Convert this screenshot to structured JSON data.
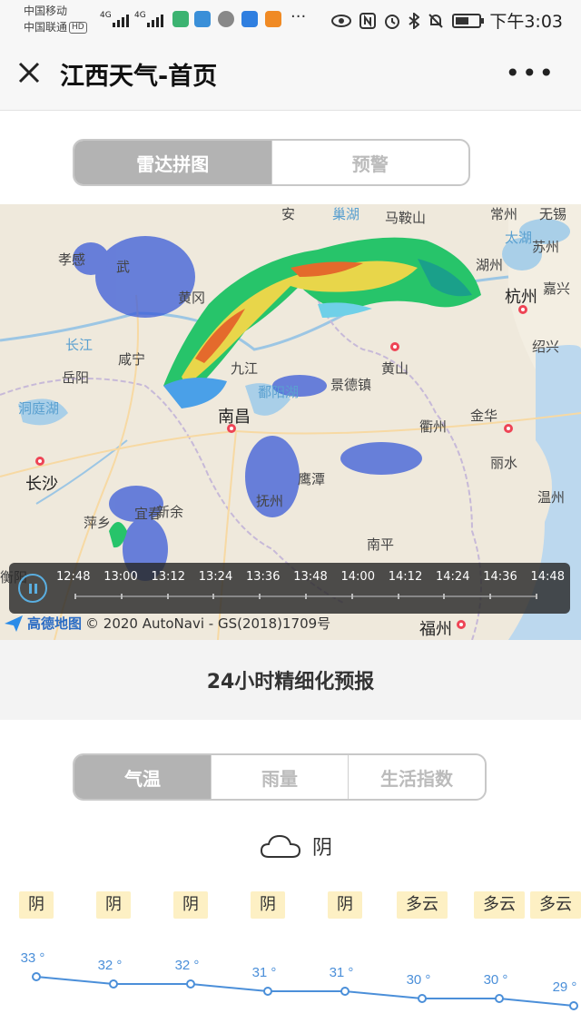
{
  "status": {
    "carrier1": "中国移动",
    "carrier2": "中国联通",
    "hd": "HD",
    "net1": "4G",
    "net2": "4G",
    "time": "下午3:03",
    "battery_level": 0.55,
    "icons": [
      "location-app-icon",
      "paper-plane-icon",
      "wechat-icon",
      "send-app-icon",
      "video-app-icon",
      "more-dots-icon",
      "eye-icon",
      "nfc-icon",
      "alarm-icon",
      "bluetooth-icon",
      "mute-bell-icon",
      "battery-icon"
    ]
  },
  "nav": {
    "title": "江西天气-首页",
    "more": "•••"
  },
  "top_tabs": [
    {
      "label": "雷达拼图",
      "active": true
    },
    {
      "label": "预警",
      "active": false
    }
  ],
  "map": {
    "labels": [
      {
        "text": "孝感",
        "name": "map-label-xiaogan"
      },
      {
        "text": "武",
        "name": "map-label-wu"
      },
      {
        "text": "黄冈",
        "name": "map-label-huanggang"
      },
      {
        "text": "长江",
        "name": "map-label-changjiang"
      },
      {
        "text": "岳阳",
        "name": "map-label-yueyang"
      },
      {
        "text": "咸宁",
        "name": "map-label-xianning"
      },
      {
        "text": "洞庭湖",
        "name": "map-label-dongting"
      },
      {
        "text": "长沙",
        "name": "map-label-changsha"
      },
      {
        "text": "南昌",
        "name": "map-label-nanchang"
      },
      {
        "text": "九江",
        "name": "map-label-jiujiang"
      },
      {
        "text": "鄱阳湖",
        "name": "map-label-poyang"
      },
      {
        "text": "景德镇",
        "name": "map-label-jingdezhen"
      },
      {
        "text": "黄山",
        "name": "map-label-huangshan"
      },
      {
        "text": "巢湖",
        "name": "map-label-chaohu"
      },
      {
        "text": "马鞍山",
        "name": "map-label-maanshan"
      },
      {
        "text": "安",
        "name": "map-label-an"
      },
      {
        "text": "常州",
        "name": "map-label-changzhou"
      },
      {
        "text": "无锡",
        "name": "map-label-wuxi"
      },
      {
        "text": "太湖",
        "name": "map-label-taihu"
      },
      {
        "text": "苏州",
        "name": "map-label-suzhou"
      },
      {
        "text": "湖州",
        "name": "map-label-huzhou"
      },
      {
        "text": "嘉兴",
        "name": "map-label-jiaxing"
      },
      {
        "text": "杭州",
        "name": "map-label-hangzhou"
      },
      {
        "text": "绍兴",
        "name": "map-label-shaoxing"
      },
      {
        "text": "衢州",
        "name": "map-label-quzhou"
      },
      {
        "text": "金华",
        "name": "map-label-jinhua"
      },
      {
        "text": "丽水",
        "name": "map-label-lishui"
      },
      {
        "text": "温州",
        "name": "map-label-wenzhou"
      },
      {
        "text": "鹰潭",
        "name": "map-label-yingtan"
      },
      {
        "text": "抚州",
        "name": "map-label-fuzhou-jx"
      },
      {
        "text": "新余",
        "name": "map-label-xinyu"
      },
      {
        "text": "宜春",
        "name": "map-label-yichun"
      },
      {
        "text": "萍乡",
        "name": "map-label-pingxiang"
      },
      {
        "text": "南平",
        "name": "map-label-nanping"
      },
      {
        "text": "福州",
        "name": "map-label-fuzhou"
      },
      {
        "text": "衡阳",
        "name": "map-label-hengyang"
      }
    ],
    "times": [
      "12:48",
      "13:00",
      "13:12",
      "13:24",
      "13:36",
      "13:48",
      "14:00",
      "14:12",
      "14:24",
      "14:36",
      "14:48"
    ],
    "credit_brand": "高德地图",
    "credit_text": "© 2020 AutoNavi - GS(2018)1709号"
  },
  "forecast": {
    "title": "24小时精细化预报",
    "tabs": [
      {
        "label": "气温",
        "active": true
      },
      {
        "label": "雨量",
        "active": false
      },
      {
        "label": "生活指数",
        "active": false
      }
    ],
    "now_condition": "阴",
    "conditions": [
      "阴",
      "阴",
      "阴",
      "阴",
      "阴",
      "多云",
      "多云",
      "多云"
    ],
    "temps": [
      "33 °",
      "32 °",
      "32 °",
      "31 °",
      "31 °",
      "30 °",
      "30 °",
      "29 °"
    ],
    "temp_values": [
      33,
      32,
      32,
      31,
      31,
      30,
      30,
      29
    ],
    "line_color": "#4b8fd9"
  }
}
